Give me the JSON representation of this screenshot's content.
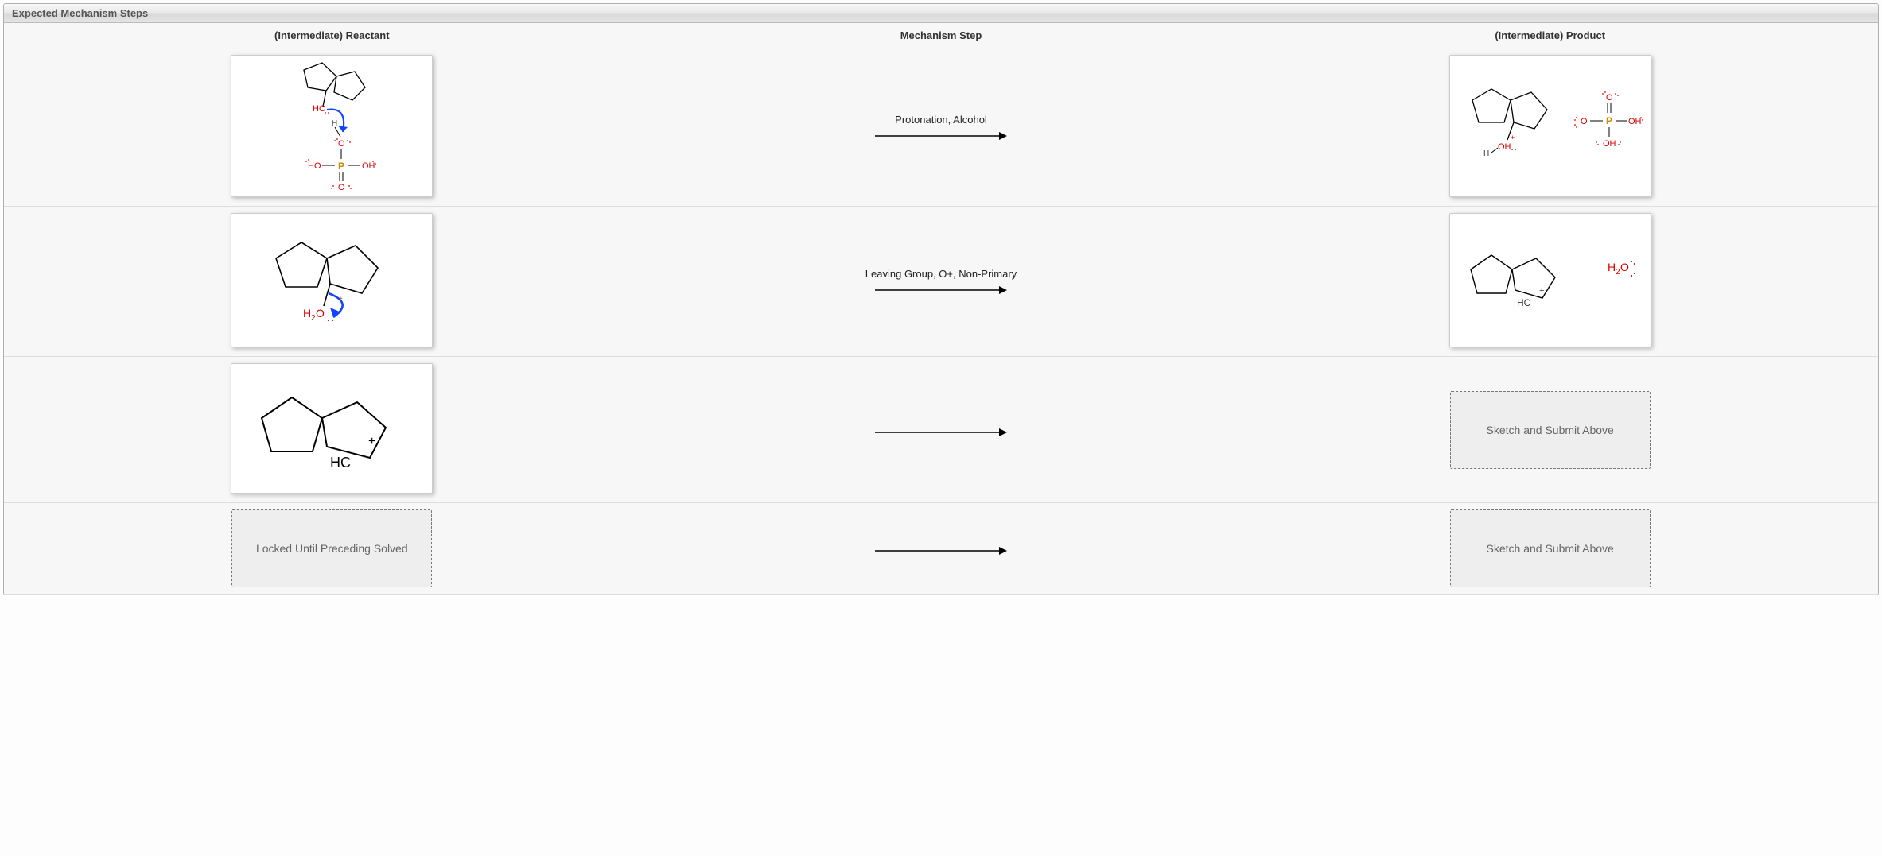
{
  "panel": {
    "title": "Expected Mechanism Steps"
  },
  "columns": {
    "reactant": "(Intermediate) Reactant",
    "step": "Mechanism Step",
    "product": "(Intermediate) Product"
  },
  "rows": [
    {
      "reactant_kind": "structure",
      "reactant_desc": "Spiro bicyclopentane with HO group; curved arrow from O lone pair to H on phosphoric acid (H3PO4 below)",
      "step_label": "Protonation, Alcohol",
      "product_kind": "structure",
      "product_desc": "Spiro bicyclopentane with protonated +OH2 group; phosphate conjugate base drawn to the right"
    },
    {
      "reactant_kind": "structure",
      "reactant_desc": "Spiro bicyclopentane with +OH2 leaving group; curved arrow showing C–O bond heterolysis to O",
      "step_label": "Leaving Group, O+, Non-Primary",
      "product_kind": "structure",
      "product_desc": "Spiro bicyclopentane secondary carbocation (HC +) and free H2O"
    },
    {
      "reactant_kind": "structure",
      "reactant_desc": "Spiro bicyclopentane secondary carbocation (HC +)",
      "step_label": "",
      "product_kind": "placeholder",
      "product_desc": "Sketch and Submit Above"
    },
    {
      "reactant_kind": "placeholder",
      "reactant_desc": "Locked Until Preceding Solved",
      "step_label": "",
      "product_kind": "placeholder",
      "product_desc": "Sketch and Submit Above"
    }
  ],
  "labels": {
    "sketch_submit": "Sketch and Submit Above",
    "locked": "Locked Until Preceding Solved"
  }
}
